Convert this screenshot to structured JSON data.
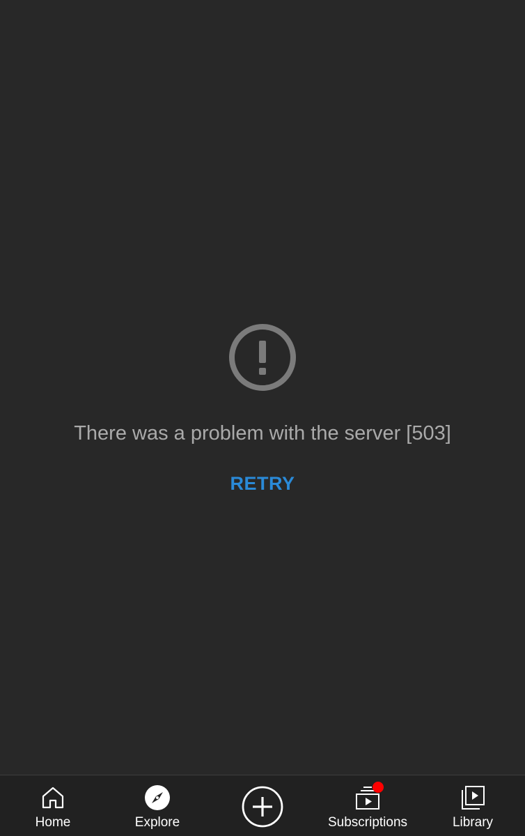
{
  "error": {
    "icon": "exclamation-circle-icon",
    "message": "There was a problem with the server [503]",
    "retry_label": "RETRY"
  },
  "nav": {
    "home": {
      "label": "Home",
      "icon": "home-icon"
    },
    "explore": {
      "label": "Explore",
      "icon": "compass-icon"
    },
    "create": {
      "icon": "plus-circle-icon"
    },
    "subscriptions": {
      "label": "Subscriptions",
      "icon": "subscriptions-icon",
      "has_notification": true
    },
    "library": {
      "label": "Library",
      "icon": "library-icon"
    }
  },
  "colors": {
    "background": "#282828",
    "nav_background": "#212121",
    "message_text": "#aaaaaa",
    "accent": "#2a8ad8",
    "badge": "#ff0000",
    "nav_text": "#ffffff"
  }
}
